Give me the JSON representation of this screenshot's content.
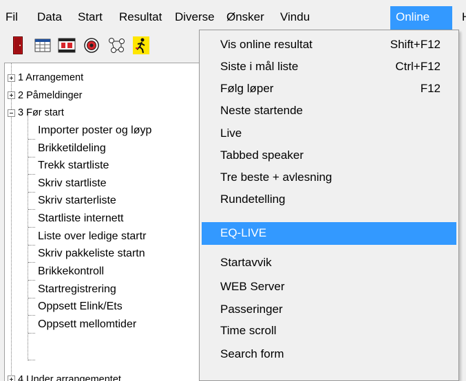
{
  "menubar": {
    "items": [
      "Fil",
      "Data",
      "Start",
      "Resultat",
      "Diverse",
      "Ønsker",
      "Vindu",
      "Online",
      "H"
    ],
    "active": "Online"
  },
  "toolbar": {
    "icons": [
      "red-door-icon",
      "calendar-grid-icon",
      "film-table-icon",
      "target-icon",
      "network-icon",
      "runner-icon"
    ]
  },
  "tree": {
    "nodes": [
      {
        "label": "1 Arrangement",
        "expander": "+"
      },
      {
        "label": "2 Påmeldinger",
        "expander": "+"
      },
      {
        "label": "3 Før start",
        "expander": "-"
      },
      {
        "label": "Importer poster og løyp"
      },
      {
        "label": "Brikketildeling"
      },
      {
        "label": "Trekk startliste"
      },
      {
        "label": "Skriv startliste"
      },
      {
        "label": "Skriv starterliste"
      },
      {
        "label": "Startliste internett"
      },
      {
        "label": "Liste over ledige startr"
      },
      {
        "label": "Skriv pakkeliste startn"
      },
      {
        "label": "Brikkekontroll"
      },
      {
        "label": "Startregistrering"
      },
      {
        "label": "Oppsett Elink/Ets"
      },
      {
        "label": "Oppsett mellomtider"
      },
      {
        "label": "4 Under arrangementet",
        "expander": "+"
      }
    ]
  },
  "online_menu": {
    "items": [
      {
        "label": "Vis online resultat",
        "shortcut": "Shift+F12"
      },
      {
        "label": "Siste i mål liste",
        "shortcut": "Ctrl+F12"
      },
      {
        "label": "Følg løper",
        "shortcut": "F12"
      },
      {
        "label": "Neste startende",
        "shortcut": ""
      },
      {
        "label": "Live",
        "shortcut": ""
      },
      {
        "label": "Tabbed speaker",
        "shortcut": ""
      },
      {
        "label": "Tre beste + avlesning",
        "shortcut": ""
      },
      {
        "label": "Rundetelling",
        "shortcut": ""
      },
      {
        "label": "EQ-LIVE",
        "shortcut": ""
      },
      {
        "label": "Startavvik",
        "shortcut": ""
      },
      {
        "label": "WEB Server",
        "shortcut": ""
      },
      {
        "label": "Passeringer",
        "shortcut": ""
      },
      {
        "label": "Time scroll",
        "shortcut": ""
      },
      {
        "label": "Search form",
        "shortcut": ""
      }
    ],
    "highlighted": "EQ-LIVE"
  },
  "colors": {
    "highlight": "#3399ff",
    "menu_bg": "#f0f0f0"
  }
}
